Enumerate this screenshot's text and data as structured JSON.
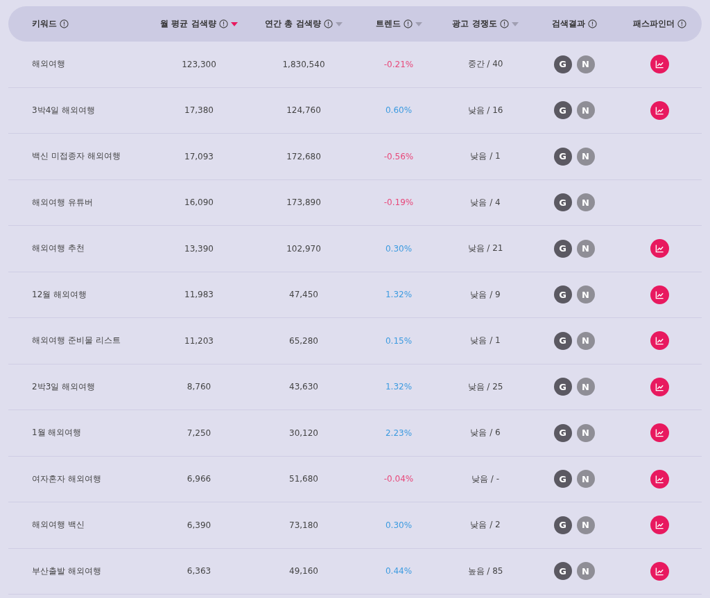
{
  "columns": [
    {
      "label": "키워드",
      "sortable": false,
      "selected": false
    },
    {
      "label": "월 평균 검색량",
      "sortable": true,
      "selected": true
    },
    {
      "label": "연간 총 검색량",
      "sortable": true,
      "selected": false
    },
    {
      "label": "트렌드",
      "sortable": true,
      "selected": false
    },
    {
      "label": "광고 경쟁도",
      "sortable": true,
      "selected": false
    },
    {
      "label": "검색결과",
      "sortable": false,
      "selected": false
    },
    {
      "label": "패스파인더",
      "sortable": false,
      "selected": false
    }
  ],
  "rows": [
    {
      "keyword": "해외여행",
      "monthly": "123,300",
      "annual": "1,830,540",
      "trend": "-0.21%",
      "competition": "중간 / 40",
      "results": [
        {
          "label": "G",
          "color": "#5b5962"
        },
        {
          "label": "N",
          "color": "#8f8e96"
        }
      ],
      "pathfinder": true
    },
    {
      "keyword": "3박4일 해외여행",
      "monthly": "17,380",
      "annual": "124,760",
      "trend": "0.60%",
      "competition": "낮음 / 16",
      "results": [
        {
          "label": "G",
          "color": "#5b5962"
        },
        {
          "label": "N",
          "color": "#8f8e96"
        }
      ],
      "pathfinder": true
    },
    {
      "keyword": "백신 미접종자 해외여행",
      "monthly": "17,093",
      "annual": "172,680",
      "trend": "-0.56%",
      "competition": "낮음 / 1",
      "results": [
        {
          "label": "G",
          "color": "#5b5962"
        },
        {
          "label": "N",
          "color": "#8f8e96"
        }
      ],
      "pathfinder": false
    },
    {
      "keyword": "해외여행 유튜버",
      "monthly": "16,090",
      "annual": "173,890",
      "trend": "-0.19%",
      "competition": "낮음 / 4",
      "results": [
        {
          "label": "G",
          "color": "#5b5962"
        },
        {
          "label": "N",
          "color": "#8f8e96"
        }
      ],
      "pathfinder": false
    },
    {
      "keyword": "해외여행 추천",
      "monthly": "13,390",
      "annual": "102,970",
      "trend": "0.30%",
      "competition": "낮음 / 21",
      "results": [
        {
          "label": "G",
          "color": "#5b5962"
        },
        {
          "label": "N",
          "color": "#8f8e96"
        }
      ],
      "pathfinder": true
    },
    {
      "keyword": "12월 해외여행",
      "monthly": "11,983",
      "annual": "47,450",
      "trend": "1.32%",
      "competition": "낮음 / 9",
      "results": [
        {
          "label": "G",
          "color": "#5b5962"
        },
        {
          "label": "N",
          "color": "#8f8e96"
        }
      ],
      "pathfinder": true
    },
    {
      "keyword": "해외여행 준비물 리스트",
      "monthly": "11,203",
      "annual": "65,280",
      "trend": "0.15%",
      "competition": "낮음 / 1",
      "results": [
        {
          "label": "G",
          "color": "#5b5962"
        },
        {
          "label": "N",
          "color": "#8f8e96"
        }
      ],
      "pathfinder": true
    },
    {
      "keyword": "2박3일 해외여행",
      "monthly": "8,760",
      "annual": "43,630",
      "trend": "1.32%",
      "competition": "낮음 / 25",
      "results": [
        {
          "label": "G",
          "color": "#5b5962"
        },
        {
          "label": "N",
          "color": "#8f8e96"
        }
      ],
      "pathfinder": true
    },
    {
      "keyword": "1월 해외여행",
      "monthly": "7,250",
      "annual": "30,120",
      "trend": "2.23%",
      "competition": "낮음 / 6",
      "results": [
        {
          "label": "G",
          "color": "#5b5962"
        },
        {
          "label": "N",
          "color": "#8f8e96"
        }
      ],
      "pathfinder": true
    },
    {
      "keyword": "여자혼자 해외여행",
      "monthly": "6,966",
      "annual": "51,680",
      "trend": "-0.04%",
      "competition": "낮음 / -",
      "results": [
        {
          "label": "G",
          "color": "#5b5962"
        },
        {
          "label": "N",
          "color": "#8f8e96"
        }
      ],
      "pathfinder": true
    },
    {
      "keyword": "해외여행 백신",
      "monthly": "6,390",
      "annual": "73,180",
      "trend": "0.30%",
      "competition": "낮음 / 2",
      "results": [
        {
          "label": "G",
          "color": "#5b5962"
        },
        {
          "label": "N",
          "color": "#8f8e96"
        }
      ],
      "pathfinder": true
    },
    {
      "keyword": "부산출발 해외여행",
      "monthly": "6,363",
      "annual": "49,160",
      "trend": "0.44%",
      "competition": "높음 / 85",
      "results": [
        {
          "label": "G",
          "color": "#5b5962"
        },
        {
          "label": "N",
          "color": "#8f8e96"
        }
      ],
      "pathfinder": true
    }
  ]
}
